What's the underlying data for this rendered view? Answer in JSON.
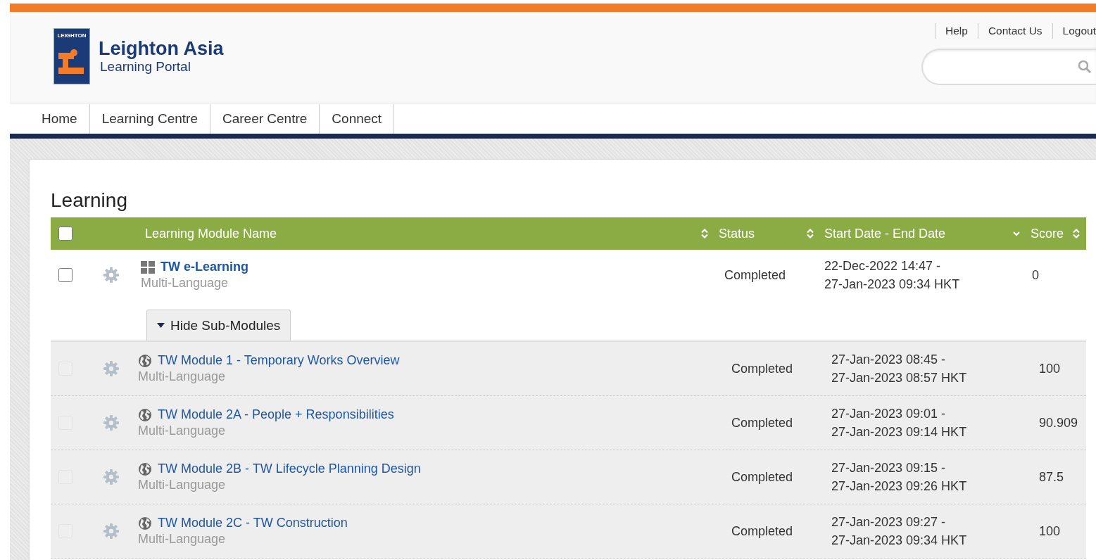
{
  "header": {
    "logo": {
      "badge_text": "LEIGHTON",
      "title": "Leighton Asia",
      "subtitle": "Learning Portal"
    },
    "links": [
      "Help",
      "Contact Us",
      "Logout"
    ]
  },
  "nav": [
    "Home",
    "Learning Centre",
    "Career Centre",
    "Connect"
  ],
  "section_title": "Learning",
  "table": {
    "select_all": {
      "checked": false
    },
    "columns": [
      {
        "label": "Learning Module Name",
        "kind": "sortable"
      },
      {
        "label": "Status",
        "kind": "sortable"
      },
      {
        "label": "Start Date - End Date",
        "kind": "sorted-desc"
      },
      {
        "label": "Score",
        "kind": "sortable"
      }
    ],
    "rows": [
      {
        "kind": "course",
        "checked": false,
        "disabled": false,
        "title": "TW e-Learning",
        "subtitle": "Multi-Language",
        "status": "Completed",
        "start": "22-Dec-2022 14:47 -",
        "end": "27-Jan-2023 09:34 HKT",
        "score": "0",
        "toggle": {
          "label": "Hide Sub-Modules",
          "expanded": true
        },
        "children": [
          {
            "kind": "module",
            "checked": false,
            "disabled": true,
            "title": "TW Module 1 - Temporary Works Overview",
            "subtitle": "Multi-Language",
            "status": "Completed",
            "start": "27-Jan-2023 08:45 -",
            "end": "27-Jan-2023 08:57 HKT",
            "score": "100"
          },
          {
            "kind": "module",
            "checked": false,
            "disabled": true,
            "title": "TW Module 2A - People + Responsibilities",
            "subtitle": "Multi-Language",
            "status": "Completed",
            "start": "27-Jan-2023 09:01 -",
            "end": "27-Jan-2023 09:14 HKT",
            "score": "90.909"
          },
          {
            "kind": "module",
            "checked": false,
            "disabled": true,
            "title": "TW Module 2B - TW Lifecycle Planning Design",
            "subtitle": "Multi-Language",
            "status": "Completed",
            "start": "27-Jan-2023 09:15 -",
            "end": "27-Jan-2023 09:26 HKT",
            "score": "87.5"
          },
          {
            "kind": "module",
            "checked": false,
            "disabled": true,
            "title": "TW Module 2C - TW Construction",
            "subtitle": "Multi-Language",
            "status": "Completed",
            "start": "27-Jan-2023 09:27 -",
            "end": "27-Jan-2023 09:34 HKT",
            "score": "100"
          }
        ]
      }
    ]
  }
}
